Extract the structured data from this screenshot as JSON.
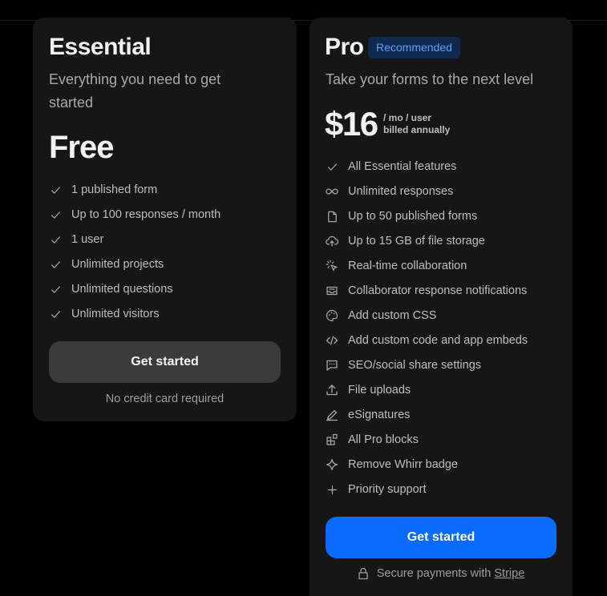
{
  "essential": {
    "title": "Essential",
    "subtitle_line1": "Everything you need to get",
    "subtitle_line2": "started",
    "price": "Free",
    "features": [
      "1 published form",
      "Up to 100 responses / month",
      "1 user",
      "Unlimited projects",
      "Unlimited questions",
      "Unlimited visitors"
    ],
    "cta_label": "Get started",
    "cta_note": "No credit card required"
  },
  "pro": {
    "title": "Pro",
    "badge": "Recommended",
    "subtitle": "Take your forms to the next level",
    "price": "$16",
    "price_period": "/ mo / user",
    "price_billing": "billed annually",
    "features": [
      {
        "label": "All Essential features",
        "icon": "check-icon"
      },
      {
        "label": "Unlimited responses",
        "icon": "infinity-icon"
      },
      {
        "label": "Up to 50 published forms",
        "icon": "file-icon"
      },
      {
        "label": "Up to 15 GB of file storage",
        "icon": "cloud-upload-icon"
      },
      {
        "label": "Real-time collaboration",
        "icon": "cursor-click-icon"
      },
      {
        "label": "Collaborator response notifications",
        "icon": "mail-icon"
      },
      {
        "label": "Add custom CSS",
        "icon": "palette-icon"
      },
      {
        "label": "Add custom code and app embeds",
        "icon": "code-icon"
      },
      {
        "label": "SEO/social share settings",
        "icon": "message-square-icon"
      },
      {
        "label": "File uploads",
        "icon": "upload-icon"
      },
      {
        "label": "eSignatures",
        "icon": "pen-icon"
      },
      {
        "label": "All Pro blocks",
        "icon": "blocks-icon"
      },
      {
        "label": "Remove Whirr badge",
        "icon": "sparkle-icon"
      },
      {
        "label": "Priority support",
        "icon": "plus-icon"
      }
    ],
    "cta_label": "Get started",
    "secure_text": "Secure payments with",
    "secure_link": "Stripe"
  },
  "colors": {
    "background": "#000000",
    "card": "#161616",
    "accent": "#0b6bff",
    "badge_bg": "#10294f",
    "badge_text": "#5aa1ff"
  }
}
